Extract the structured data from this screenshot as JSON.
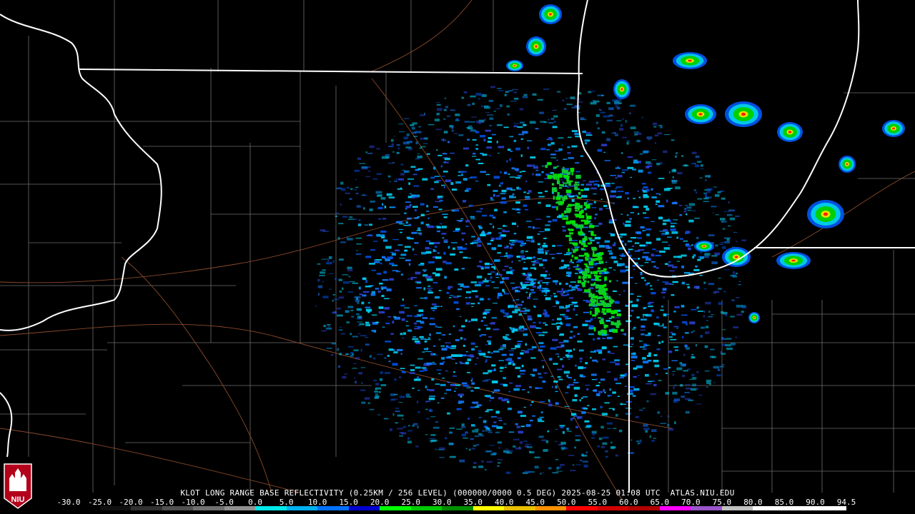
{
  "product": {
    "caption": "KLOT LONG RANGE BASE REFLECTIVITY (0.25KM / 256 LEVEL) (000000/0000 0.5 DEG) 2025-08-25 01:08 UTC  ATLAS.NIU.EDU",
    "logo_text": "NIU"
  },
  "scale": {
    "labels": [
      "-30.0",
      "-25.0",
      "-20.0",
      "-15.0",
      "-10.0",
      "-5.0",
      "0.0",
      "5.0",
      "10.0",
      "15.0",
      "20.0",
      "25.0",
      "30.0",
      "35.0",
      "40.0",
      "45.0",
      "50.0",
      "55.0",
      "60.0",
      "65.0",
      "70.0",
      "75.0",
      "80.0",
      "85.0",
      "90.0",
      "94.5"
    ],
    "colors": [
      "#000000",
      "#101010",
      "#303030",
      "#505050",
      "#707070",
      "#909090",
      "#00e8e8",
      "#00b0f0",
      "#0070ff",
      "#0000d0",
      "#00ff00",
      "#00c800",
      "#008c00",
      "#ffff00",
      "#e8c000",
      "#ff9000",
      "#ff0000",
      "#d00000",
      "#b00000",
      "#ff00ff",
      "#9955c9",
      "#c0c0c0",
      "#ffffff",
      "#ffffff",
      "#ffffff"
    ]
  },
  "map_features": [
    "state-boundaries",
    "county-lines",
    "lake-michigan-shoreline",
    "radar-echo-field",
    "storm-cells"
  ]
}
